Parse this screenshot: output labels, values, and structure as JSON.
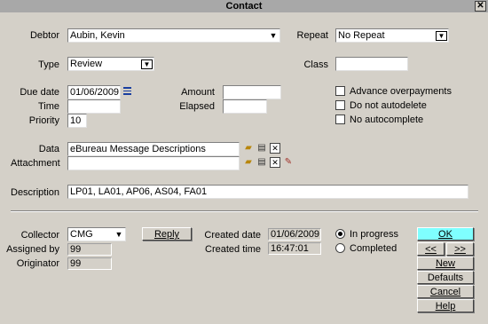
{
  "window": {
    "title": "Contact",
    "close_glyph": "✕"
  },
  "fields": {
    "debtor": {
      "label": "Debtor",
      "value": "Aubin, Kevin"
    },
    "repeat": {
      "label": "Repeat",
      "value": "No Repeat"
    },
    "type": {
      "label": "Type",
      "value": "Review"
    },
    "class": {
      "label": "Class",
      "value": ""
    },
    "due_date": {
      "label": "Due date",
      "value": "01/06/2009"
    },
    "time": {
      "label": "Time",
      "value": ""
    },
    "priority": {
      "label": "Priority",
      "value": "10"
    },
    "amount": {
      "label": "Amount",
      "value": ""
    },
    "elapsed": {
      "label": "Elapsed",
      "value": ""
    },
    "data": {
      "label": "Data",
      "value": "eBureau Message Descriptions"
    },
    "attachment": {
      "label": "Attachment",
      "value": ""
    },
    "description": {
      "label": "Description",
      "value": "LP01, LA01, AP06, AS04, FA01"
    },
    "collector": {
      "label": "Collector",
      "value": "CMG"
    },
    "assigned_by": {
      "label": "Assigned by",
      "value": "99"
    },
    "originator": {
      "label": "Originator",
      "value": "99"
    },
    "created_date": {
      "label": "Created date",
      "value": "01/06/2009"
    },
    "created_time": {
      "label": "Created time",
      "value": "16:47:01"
    }
  },
  "checkboxes": {
    "advance_overpayments": {
      "label": "Advance overpayments",
      "checked": false
    },
    "do_not_autodelete": {
      "label": "Do not autodelete",
      "checked": false
    },
    "no_autocomplete": {
      "label": "No autocomplete",
      "checked": false
    }
  },
  "status": {
    "in_progress": {
      "label": "In progress",
      "selected": true
    },
    "completed": {
      "label": "Completed",
      "selected": false
    }
  },
  "buttons": {
    "reply": "Reply",
    "ok": "OK",
    "prev": "<<",
    "next": ">>",
    "new": "New",
    "defaults": "Defaults",
    "cancel": "Cancel",
    "help": "Help"
  },
  "glyphs": {
    "dropdown": "▼",
    "delete": "✕"
  },
  "icons": [
    "calendar-list-icon",
    "open-folder-icon",
    "print-icon",
    "delete-icon",
    "attach-edit-icon"
  ],
  "colors": {
    "ok_button": "#7fffff",
    "titlebar": "#a8a8a8",
    "face": "#d4d0c8"
  }
}
